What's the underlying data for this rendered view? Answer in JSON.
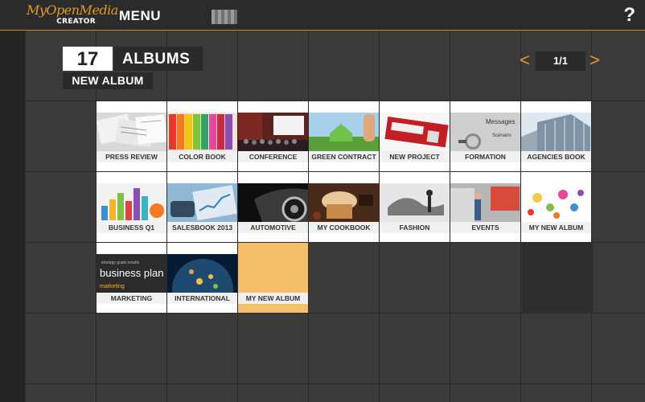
{
  "header": {
    "logo_script": "MyOpenMedia",
    "logo_sub": "CREATOR",
    "menu_label": "MENU",
    "help_label": "?"
  },
  "albums": {
    "count": "17",
    "label": "ALBUMS",
    "new_album_label": "NEW ALBUM"
  },
  "pager": {
    "prev": "<",
    "page": "1/1",
    "next": ">"
  },
  "tiles": [
    {
      "label": "PRESS REVIEW",
      "thumb": "newspapers"
    },
    {
      "label": "COLOR BOOK",
      "thumb": "colored-pencils"
    },
    {
      "label": "CONFERENCE",
      "thumb": "conference-room"
    },
    {
      "label": "GREEN CONTRACT",
      "thumb": "green-house-hand"
    },
    {
      "label": "NEW PROJECT",
      "thumb": "confidential-binder"
    },
    {
      "label": "FORMATION",
      "thumb": "lightbulb-messages"
    },
    {
      "label": "AGENCIES BOOK",
      "thumb": "office-building"
    },
    {
      "label": "BUSINESS Q1",
      "thumb": "bar-charts"
    },
    {
      "label": "SALESBOOK 2013",
      "thumb": "tablet-chart"
    },
    {
      "label": "AUTOMOTIVE",
      "thumb": "car-wheel"
    },
    {
      "label": "MY COOKBOOK",
      "thumb": "cupcake"
    },
    {
      "label": "FASHION",
      "thumb": "dancer-splash"
    },
    {
      "label": "EVENTS",
      "thumb": "expo-stand"
    },
    {
      "label": "MY NEW ALBUM",
      "thumb": "flower-doodles"
    },
    {
      "label": "MARKETING",
      "thumb": "business-plan-chalkboard"
    },
    {
      "label": "INTERNATIONAL",
      "thumb": "earth-lights"
    },
    {
      "label": "MY NEW ALBUM",
      "thumb": "blank"
    }
  ],
  "colors": {
    "accent": "#e39a22",
    "background": "#3b3b3b",
    "topbar": "#2b2b2b",
    "blank_tile": "#f6bf6c"
  }
}
